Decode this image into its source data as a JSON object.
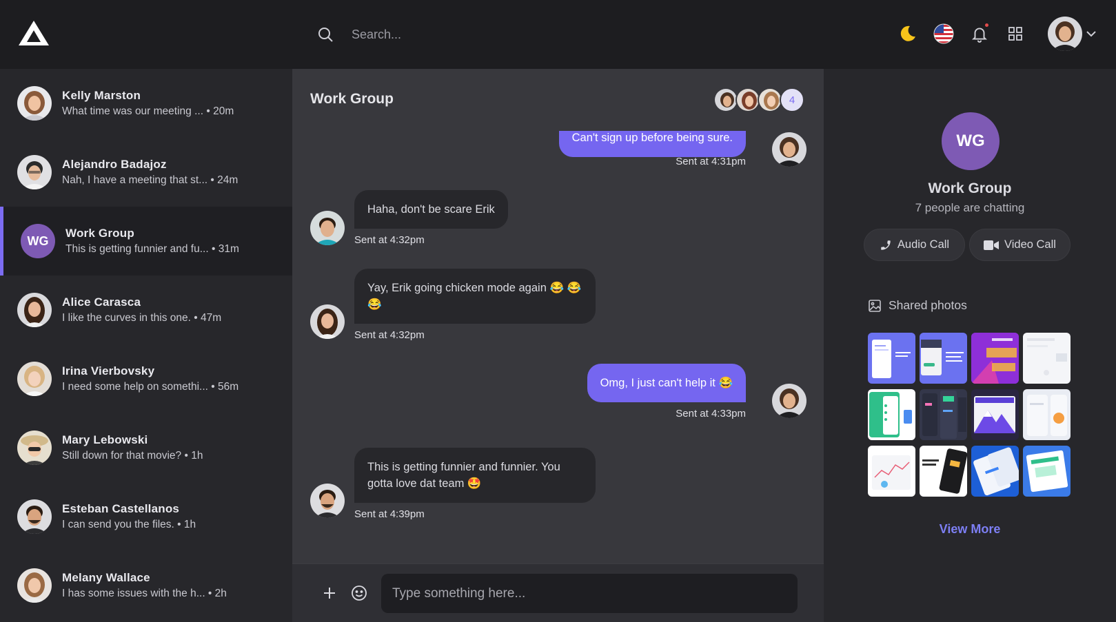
{
  "topbar": {
    "search_placeholder": "Search..."
  },
  "conversations": [
    {
      "name": "Kelly Marston",
      "preview": "What time was our meeting ...",
      "time": "20m"
    },
    {
      "name": "Alejandro Badajoz",
      "preview": "Nah, I have a meeting that st...",
      "time": "24m"
    },
    {
      "name": "Work Group",
      "preview": "This is getting funnier and fu...",
      "time": "31m",
      "initials": "WG"
    },
    {
      "name": "Alice Carasca",
      "preview": "I like the curves in this one.",
      "time": "47m"
    },
    {
      "name": "Irina Vierbovsky",
      "preview": "I need some help on somethi...",
      "time": "56m"
    },
    {
      "name": "Mary Lebowski",
      "preview": "Still down for that movie?",
      "time": "1h"
    },
    {
      "name": "Esteban Castellanos",
      "preview": "I can send you the files.",
      "time": "1h"
    },
    {
      "name": "Melany Wallace",
      "preview": "I has some issues with the h...",
      "time": "2h"
    }
  ],
  "chat": {
    "title": "Work Group",
    "member_count": "4",
    "messages": [
      {
        "text": "Can't sign up before being sure.",
        "meta": "Sent at 4:31pm"
      },
      {
        "text": "Haha, don't be scare Erik",
        "meta": "Sent at 4:32pm"
      },
      {
        "text": "Yay, Erik going chicken mode again 😂 😂 😂",
        "meta": "Sent at 4:32pm"
      },
      {
        "text": "Omg, I just can't help it 😂",
        "meta": "Sent at 4:33pm"
      },
      {
        "text": "This is getting funnier and funnier. You gotta love dat team 🤩",
        "meta": "Sent at 4:39pm"
      }
    ],
    "composer_placeholder": "Type something here..."
  },
  "details": {
    "initials": "WG",
    "name": "Work Group",
    "subtitle": "7 people are chatting",
    "audio_call": "Audio Call",
    "video_call": "Video Call",
    "shared_photos": "Shared photos",
    "view_more": "View More"
  },
  "colors": {
    "accent": "#7566f0",
    "group_avatar": "#7e5ab4",
    "link": "#7d7ff4"
  }
}
